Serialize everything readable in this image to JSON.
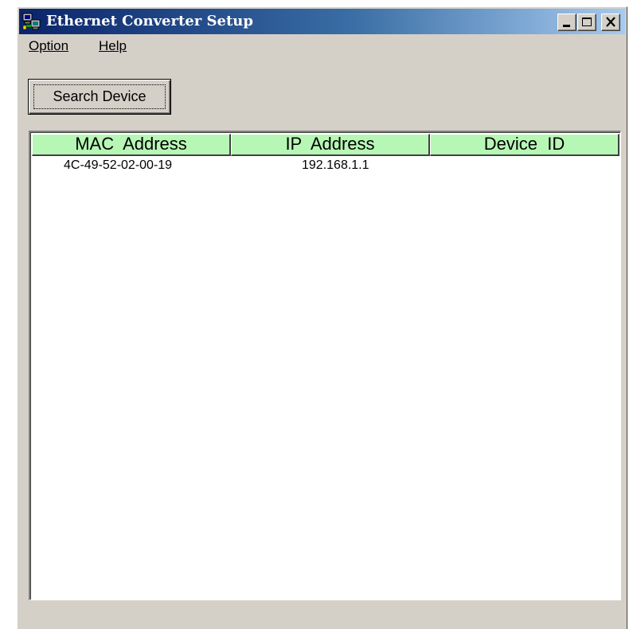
{
  "window": {
    "title": "Ethernet Converter Setup",
    "icon": "network-computers-icon",
    "controls": [
      "minimize-icon",
      "maximize-icon",
      "close-icon"
    ]
  },
  "menu": {
    "option_label": "Option",
    "help_label": "Help"
  },
  "toolbar": {
    "search_label": "Search Device"
  },
  "device_list": {
    "columns": [
      "MAC  Address",
      "IP  Address",
      "Device  ID"
    ],
    "header_color": "#b7f7b5",
    "rows": [
      {
        "mac": "4C-49-52-02-00-19",
        "ip": "192.168.1.1",
        "device_id": ""
      }
    ]
  },
  "colors": {
    "title_gradient_start": "#0a246a",
    "title_gradient_end": "#a6caf0",
    "window_face": "#d4d0c8"
  }
}
